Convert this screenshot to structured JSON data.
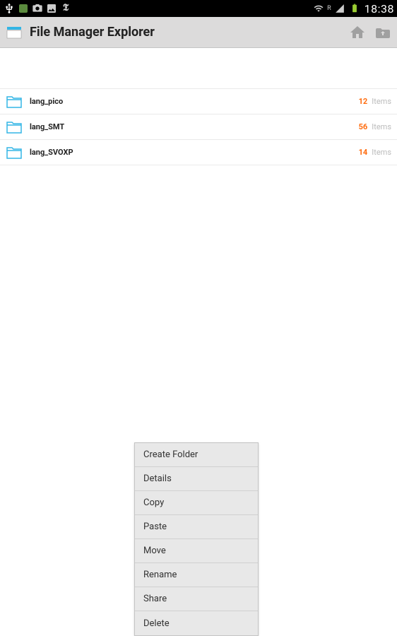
{
  "status_bar": {
    "time": "18:38"
  },
  "app_bar": {
    "title": "File Manager Explorer"
  },
  "files": [
    {
      "name": "lang_pico",
      "count": "12",
      "unit": "Items"
    },
    {
      "name": "lang_SMT",
      "count": "56",
      "unit": "Items"
    },
    {
      "name": "lang_SVOXP",
      "count": "14",
      "unit": "Items"
    }
  ],
  "context_menu": {
    "items": [
      "Create Folder",
      "Details",
      "Copy",
      "Paste",
      "Move",
      "Rename",
      "Share",
      "Delete"
    ]
  }
}
